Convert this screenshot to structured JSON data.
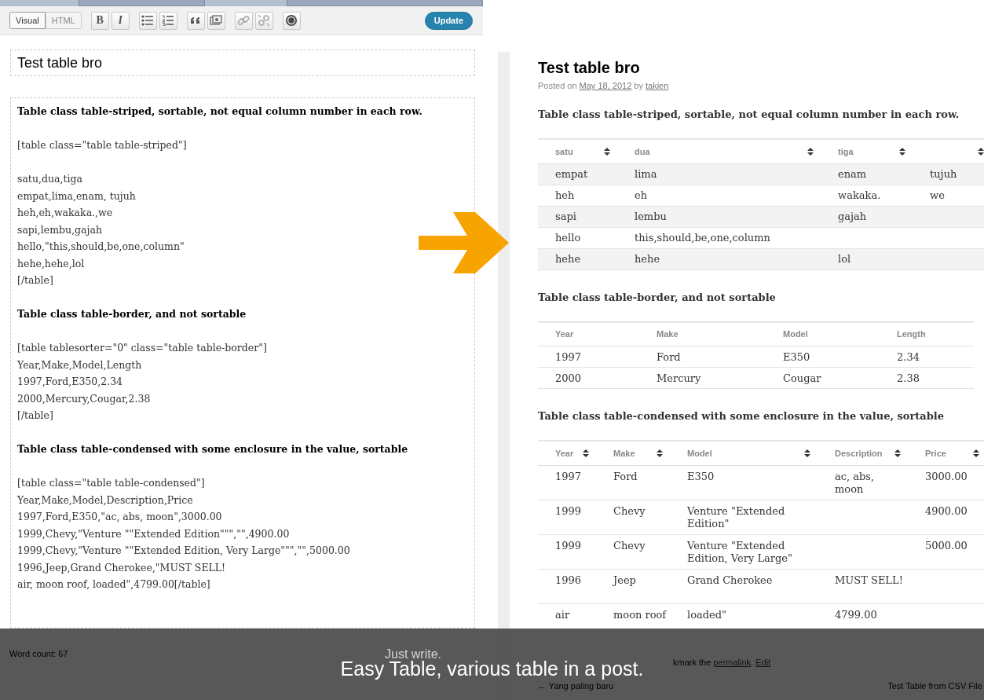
{
  "toolbar": {
    "modes": [
      {
        "label": "Visual",
        "selected": true
      },
      {
        "label": "HTML",
        "selected": false
      }
    ],
    "format_buttons": [
      {
        "label": "B",
        "kind": "bold"
      },
      {
        "label": "I",
        "kind": "italic"
      }
    ],
    "update_button": "Update"
  },
  "editor": {
    "title": "Test table bro",
    "paragraphs": [
      {
        "kind": "heading",
        "lines": [
          "Table class table-striped, sortable, not equal column number in each row."
        ]
      },
      {
        "kind": "text",
        "lines": [
          "[table class=\"table table-striped\"]"
        ]
      },
      {
        "kind": "text",
        "lines": [
          "satu,dua,tiga",
          "empat,lima,enam, tujuh",
          "heh,eh,wakaka.,we",
          "sapi,lembu,gajah",
          "hello,\"this,should,be,one,column\"",
          "hehe,hehe,lol",
          "[/table]"
        ]
      },
      {
        "kind": "heading",
        "lines": [
          "Table class table-border, and not sortable"
        ]
      },
      {
        "kind": "text",
        "lines": [
          "[table tablesorter=\"0\" class=\"table table-border\"]",
          "Year,Make,Model,Length",
          "1997,Ford,E350,2.34",
          "2000,Mercury,Cougar,2.38",
          "[/table]"
        ]
      },
      {
        "kind": "heading",
        "lines": [
          "Table class table-condensed with some enclosure in the value, sortable"
        ]
      },
      {
        "kind": "text",
        "lines": [
          "[table class=\"table table-condensed\"]",
          "Year,Make,Model,Description,Price",
          "1997,Ford,E350,\"ac, abs, moon\",3000.00",
          "1999,Chevy,\"Venture \"\"Extended Edition\"\"\",\"\",4900.00",
          "1999,Chevy,\"Venture \"\"Extended Edition, Very Large\"\"\",\"\",5000.00",
          "1996,Jeep,Grand Cherokee,\"MUST SELL!",
          "air, moon roof, loaded\",4799.00[/table]"
        ]
      }
    ],
    "word_count": "Word count: 67",
    "status": "Just write."
  },
  "post": {
    "title": "Test table bro",
    "meta": {
      "prefix": "Posted on",
      "date": "May 18, 2012",
      "by": "by",
      "author": "takien"
    },
    "sections": [
      {
        "heading": "Table class table-striped, sortable, not equal column number in each row.",
        "striped": true,
        "sortable": true,
        "condensed": false,
        "columns": [
          {
            "label": "satu"
          },
          {
            "label": "dua"
          },
          {
            "label": "tiga"
          },
          {}
        ],
        "rows": [
          [
            "empat",
            "lima",
            "enam",
            "tujuh"
          ],
          [
            "heh",
            "eh",
            "wakaka.",
            "we"
          ],
          [
            "sapi",
            "lembu",
            "gajah",
            null
          ],
          [
            "hello",
            "this,should,be,one,column",
            null,
            null
          ],
          [
            "hehe",
            "hehe",
            "lol",
            null
          ]
        ]
      },
      {
        "heading": "Table class table-border, and not sortable",
        "striped": false,
        "sortable": false,
        "condensed": false,
        "columns": [
          {
            "label": "Year"
          },
          {
            "label": "Make"
          },
          {
            "label": "Model"
          },
          {
            "label": "Length"
          }
        ],
        "rows": [
          [
            "1997",
            "Ford",
            "E350",
            "2.34"
          ],
          [
            "2000",
            "Mercury",
            "Cougar",
            "2.38"
          ]
        ]
      },
      {
        "heading": "Table class table-condensed with some enclosure in the value, sortable",
        "striped": false,
        "sortable": true,
        "condensed": true,
        "columns": [
          {
            "label": "Year"
          },
          {
            "label": "Make"
          },
          {
            "label": "Model"
          },
          {
            "label": "Description"
          },
          {
            "label": "Price"
          }
        ],
        "rows": [
          [
            "1997",
            "Ford",
            "E350",
            "ac, abs, moon",
            "3000.00"
          ],
          [
            "1999",
            "Chevy",
            "Venture \"Extended Edition\"",
            null,
            "4900.00"
          ],
          [
            "1999",
            "Chevy",
            "Venture \"Extended Edition, Very Large\"",
            null,
            "5000.00"
          ],
          [
            "1996",
            "Jeep",
            "Grand Cherokee",
            "MUST SELL!",
            null
          ],
          [
            "air",
            "moon roof",
            "loaded\"",
            "4799.00",
            null
          ]
        ]
      }
    ],
    "footer": {
      "text": "kmark the",
      "permalink": "permalink",
      "separator": ".",
      "edit": "Edit"
    },
    "nav": {
      "previous": "← Yang paling baru",
      "next": "Test Table from CSV File"
    }
  },
  "caption": "Easy Table, various table in a post."
}
